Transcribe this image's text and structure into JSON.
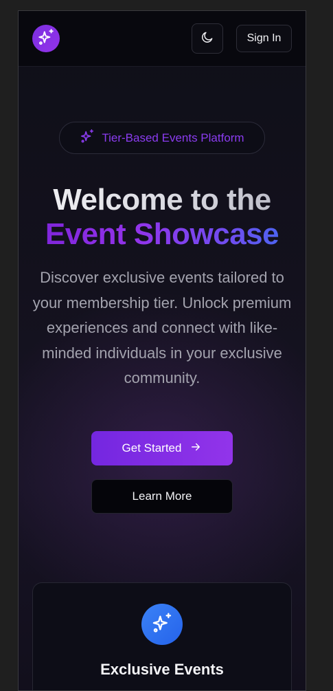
{
  "header": {
    "logo_icon": "sparkles-icon",
    "theme_icon": "moon-icon",
    "signin_label": "Sign In"
  },
  "hero": {
    "badge_icon": "sparkles-icon",
    "badge_label": "Tier-Based Events Platform",
    "title_line1": "Welcome to the",
    "title_line2": "Event Showcase",
    "description": "Discover exclusive events tailored to your membership tier. Unlock premium experiences and connect with like-minded individuals in your exclusive community.",
    "primary_button": "Get Started",
    "primary_button_icon": "arrow-right-icon",
    "secondary_button": "Learn More"
  },
  "features": [
    {
      "icon": "sparkles-icon",
      "title": "Exclusive Events"
    }
  ],
  "colors": {
    "accent_purple": "#9333ea",
    "accent_blue": "#3b82f6",
    "background": "#0f0f18"
  }
}
